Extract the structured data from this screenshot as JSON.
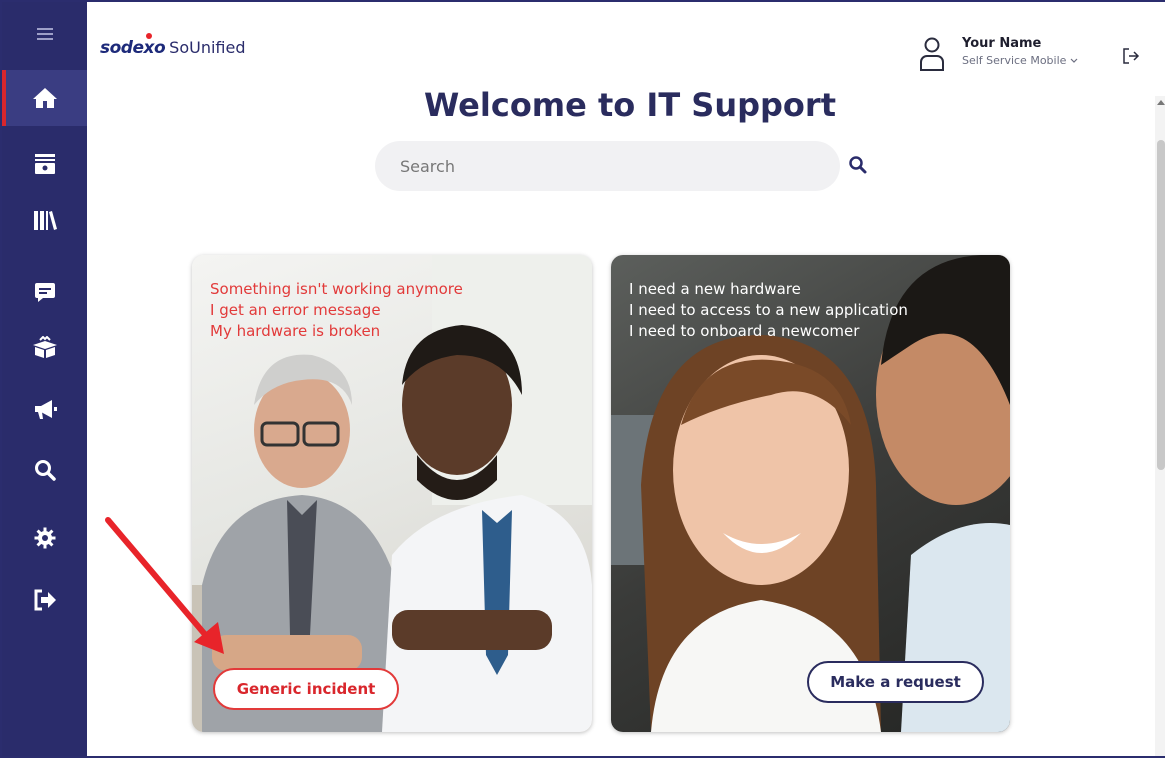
{
  "brand": {
    "logo_text": "sodexo",
    "app_name": "SoUnified"
  },
  "sidebar": {
    "items": [
      {
        "icon": "hamburger-menu-icon"
      },
      {
        "icon": "home-icon",
        "active": true
      },
      {
        "icon": "inbox-icon"
      },
      {
        "icon": "library-icon"
      },
      {
        "icon": "chat-icon"
      },
      {
        "icon": "package-icon"
      },
      {
        "icon": "megaphone-icon"
      },
      {
        "icon": "search-icon"
      },
      {
        "icon": "gear-icon"
      },
      {
        "icon": "sign-out-icon"
      }
    ]
  },
  "header": {
    "user_name": "Your Name",
    "user_role": "Self Service Mobile",
    "logout_icon": "sign-out-icon"
  },
  "main": {
    "title": "Welcome to IT Support",
    "search": {
      "placeholder": "Search",
      "icon": "search-icon"
    }
  },
  "cards": [
    {
      "lines": [
        "Something isn't working anymore",
        "I get an error message",
        "My hardware is broken"
      ],
      "button": "Generic incident",
      "accent": "#e23a3a"
    },
    {
      "lines": [
        "I need a new hardware",
        "I need to access to a new application",
        "I need to onboard a newcomer"
      ],
      "button": "Make a request",
      "accent": "#2a2c5e"
    }
  ],
  "colors": {
    "sidebar": "#2a2c6b",
    "title": "#2a2c5e",
    "annotation_arrow": "#e8242a"
  }
}
